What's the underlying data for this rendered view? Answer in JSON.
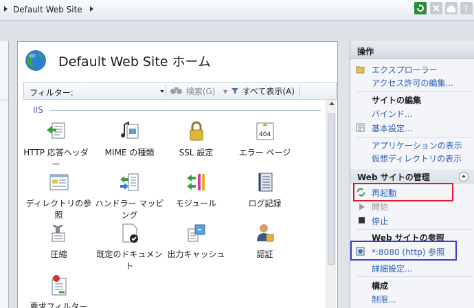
{
  "breadcrumb": {
    "site": "Default Web Site"
  },
  "toolbar": {
    "icons": [
      "refresh-icon",
      "stop-icon",
      "home-icon",
      "help-icon"
    ]
  },
  "main": {
    "title": "Default Web Site ホーム",
    "filter_label": "フィルター:",
    "filter_value": "",
    "search_label": "検索(G)",
    "showall_label": "すべて表示(A)",
    "group": "IIS",
    "features": [
      {
        "label": "HTTP 応答ヘッダー",
        "icon": "http-response-headers-icon"
      },
      {
        "label": "MIME の種類",
        "icon": "mime-types-icon"
      },
      {
        "label": "SSL 設定",
        "icon": "ssl-lock-icon"
      },
      {
        "label": "エラー ページ",
        "icon": "error-page-404-icon"
      },
      {
        "label": "ディレクトリの参照",
        "icon": "directory-browsing-icon"
      },
      {
        "label": "ハンドラー マッピング",
        "icon": "handler-mappings-icon"
      },
      {
        "label": "モジュール",
        "icon": "modules-icon"
      },
      {
        "label": "ログ記録",
        "icon": "logging-icon"
      },
      {
        "label": "圧縮",
        "icon": "compression-icon"
      },
      {
        "label": "既定のドキュメント",
        "icon": "default-document-icon"
      },
      {
        "label": "出力キャッシュ",
        "icon": "output-caching-icon"
      },
      {
        "label": "認証",
        "icon": "authentication-icon"
      },
      {
        "label": "要求フィルター",
        "icon": "request-filtering-icon"
      }
    ]
  },
  "actions": {
    "header": "操作",
    "explore": "エクスプローラー",
    "edit_permissions": "アクセス許可の編集...",
    "edit_site_heading": "サイトの編集",
    "bindings": "バインド...",
    "basic_settings": "基本設定...",
    "view_applications": "アプリケーションの表示",
    "view_virtual_dirs": "仮想ディレクトリの表示",
    "manage_heading": "Web サイトの管理",
    "restart": "再起動",
    "start": "開始",
    "stop": "停止",
    "browse_heading": "Web サイトの参照",
    "browse_link": "*:8080 (http) 参照",
    "advanced_settings": "詳細設定...",
    "configure_heading": "構成",
    "limits": "制限..."
  },
  "colors": {
    "link": "#2f5fb8",
    "highlight_red": "#e0182a",
    "highlight_blue": "#3b3bcc"
  }
}
